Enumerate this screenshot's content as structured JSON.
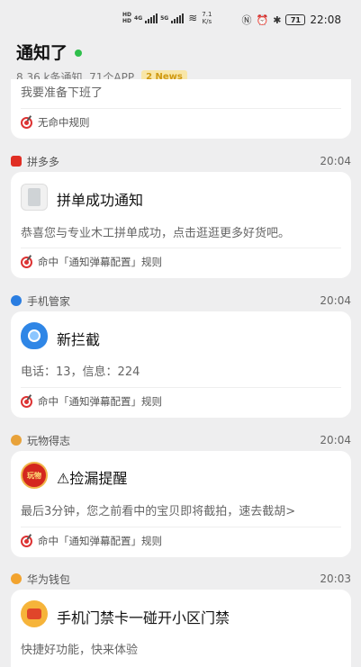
{
  "status_bar": {
    "net1": "HD",
    "net1b": "HD",
    "sig1": "4G",
    "sig2": "5G",
    "speed": "7.1",
    "speed_unit": "K/s",
    "battery": "71",
    "time": "22:08"
  },
  "header": {
    "title": "通知了",
    "subtitle": "8.36 k条通知, 71个APP",
    "news_badge": "2 News"
  },
  "rule_nohit": "无命中规则",
  "rule_hit": "命中「通知弹幕配置」规则",
  "top_card": {
    "body": "我要准备下班了"
  },
  "groups": [
    {
      "app": "拼多多",
      "time": "20:04",
      "title": "拼单成功通知",
      "body": "恭喜您与专业木工拼单成功，点击逛逛更多好货吧。"
    },
    {
      "app": "手机管家",
      "time": "20:04",
      "title": "新拦截",
      "body": "电话：13，信息：224"
    },
    {
      "app": "玩物得志",
      "time": "20:04",
      "title": "⚠捡漏提醒",
      "body": "最后3分钟，您之前看中的宝贝即将截拍，速去截胡>"
    },
    {
      "app": "华为钱包",
      "time": "20:03",
      "title": "手机门禁卡一碰开小区门禁",
      "body": "快捷好功能，快来体验"
    }
  ],
  "app_icon_text": {
    "wanwu": "玩物"
  },
  "colors": {
    "accent_green": "#2fbf4c",
    "badge_bg": "#f8e6a8",
    "badge_text": "#d09a12",
    "rule_red": "#d33333"
  }
}
